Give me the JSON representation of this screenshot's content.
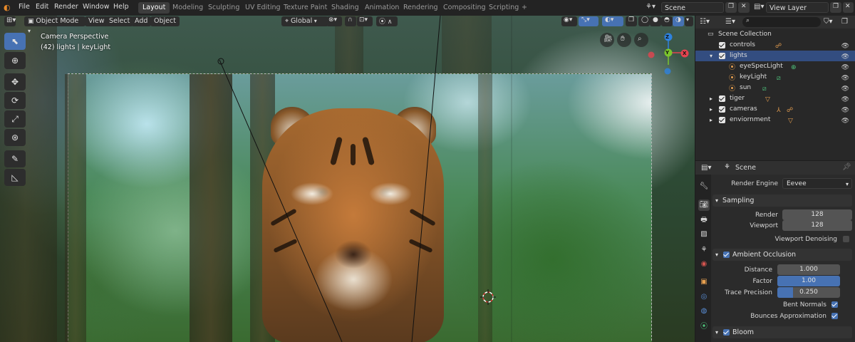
{
  "menubar": {
    "items": [
      "File",
      "Edit",
      "Render",
      "Window",
      "Help"
    ],
    "workspaces": [
      "Layout",
      "Modeling",
      "Sculpting",
      "UV Editing",
      "Texture Paint",
      "Shading",
      "Animation",
      "Rendering",
      "Compositing",
      "Scripting"
    ],
    "active_workspace": "Layout",
    "add_tab": "+",
    "scene_field": "Scene",
    "view_layer_field": "View Layer"
  },
  "viewport_header": {
    "mode": "Object Mode",
    "menus": [
      "View",
      "Select",
      "Add",
      "Object"
    ],
    "orientation": "Global"
  },
  "viewport": {
    "overlay_title": "Camera Perspective",
    "overlay_subtitle": "(42) lights | keyLight",
    "gizmo_axes": {
      "x": "X",
      "y": "Y",
      "z": "Z"
    }
  },
  "outliner": {
    "root": "Scene Collection",
    "rows": [
      {
        "label": "controls",
        "type": "collection"
      },
      {
        "label": "lights",
        "type": "collection",
        "selected": true
      },
      {
        "label": "eyeSpecLight",
        "type": "light"
      },
      {
        "label": "keyLight",
        "type": "light"
      },
      {
        "label": "sun",
        "type": "light"
      },
      {
        "label": "tiger",
        "type": "collection"
      },
      {
        "label": "cameras",
        "type": "collection"
      },
      {
        "label": "enviornment",
        "type": "collection"
      }
    ]
  },
  "properties": {
    "context": "Scene",
    "render_engine_label": "Render Engine",
    "render_engine_value": "Eevee",
    "sampling": {
      "title": "Sampling",
      "render_label": "Render",
      "render_value": "128",
      "viewport_label": "Viewport",
      "viewport_value": "128",
      "denoise_label": "Viewport Denoising",
      "denoise_checked": false
    },
    "ambient_occlusion": {
      "title": "Ambient Occlusion",
      "enabled": true,
      "distance_label": "Distance",
      "distance_value": "1.000",
      "factor_label": "Factor",
      "factor_value": "1.00",
      "factor_fill": 1.0,
      "trace_label": "Trace Precision",
      "trace_value": "0.250",
      "trace_fill": 0.25,
      "bent_label": "Bent Normals",
      "bent_checked": true,
      "bounces_label": "Bounces Approximation",
      "bounces_checked": true
    },
    "bloom": {
      "title": "Bloom",
      "enabled": true
    }
  },
  "colors": {
    "accent": "#4772b3",
    "selection": "#334d80",
    "axis_x": "#e5434f",
    "axis_y": "#7bc62d",
    "axis_z": "#2e82e0"
  }
}
